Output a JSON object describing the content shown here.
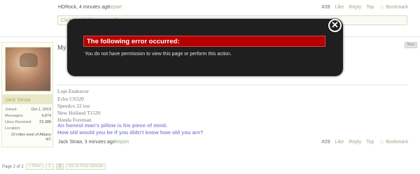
{
  "top_post": {
    "author_time": "HDRock, 4 minutes ago",
    "report": "Report",
    "number": "#28",
    "like": "Like",
    "reply": "Reply",
    "top": "Top",
    "bookmark": "Bookmark",
    "reply_hint": "Click to add this tutor as like"
  },
  "user": {
    "name": "Jack Straw",
    "stats": [
      {
        "label": "Joined:",
        "value": "Oct 1, 2013"
      },
      {
        "label": "Messages:",
        "value": "4,874"
      },
      {
        "label": "Likes Received:",
        "value": "23,388"
      }
    ],
    "location_label": "Location:",
    "location_value": "10 miles west of Albany NY"
  },
  "post": {
    "title": "My p",
    "lines": [
      "Lopi Endeavor",
      "Echo CS520",
      "Speedco 22 ton",
      "New Holland T1520",
      "Honda Foreman"
    ],
    "quotes": [
      "An honest man's pillow is his piece of mind.",
      "How old would you be if you didn't know how old you are?"
    ],
    "author_time": "Jack Straw, 3 minutes ago",
    "report": "Report",
    "number": "#29",
    "like": "Like",
    "reply": "Reply",
    "top": "Top",
    "bookmark": "Bookmark",
    "new_badge": "New"
  },
  "pager": {
    "label": "Page 2 of 2",
    "prev": "< Prev",
    "page1": "1",
    "page2": "2",
    "first_unread": "Go to First Unread"
  },
  "modal": {
    "heading": "The following error occurred:",
    "message": "You do not have permission to view this page or perform this action.",
    "close_symbol": "✕"
  }
}
